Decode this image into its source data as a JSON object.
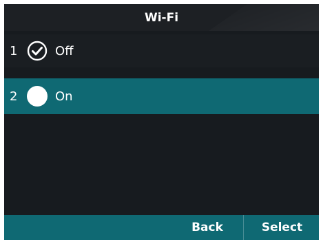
{
  "header": {
    "title": "Wi-Fi"
  },
  "options": [
    {
      "number": "1",
      "label": "Off",
      "icon": "check-circle-icon",
      "selected": false,
      "checked": true
    },
    {
      "number": "2",
      "label": "On",
      "icon": "filled-circle-icon",
      "selected": true,
      "checked": false
    }
  ],
  "soft_keys": {
    "back_label": "Back",
    "select_label": "Select"
  },
  "colors": {
    "background": "#171b1f",
    "title_bar": "#1d2024",
    "highlight": "#0f6973",
    "text": "#ffffff"
  }
}
